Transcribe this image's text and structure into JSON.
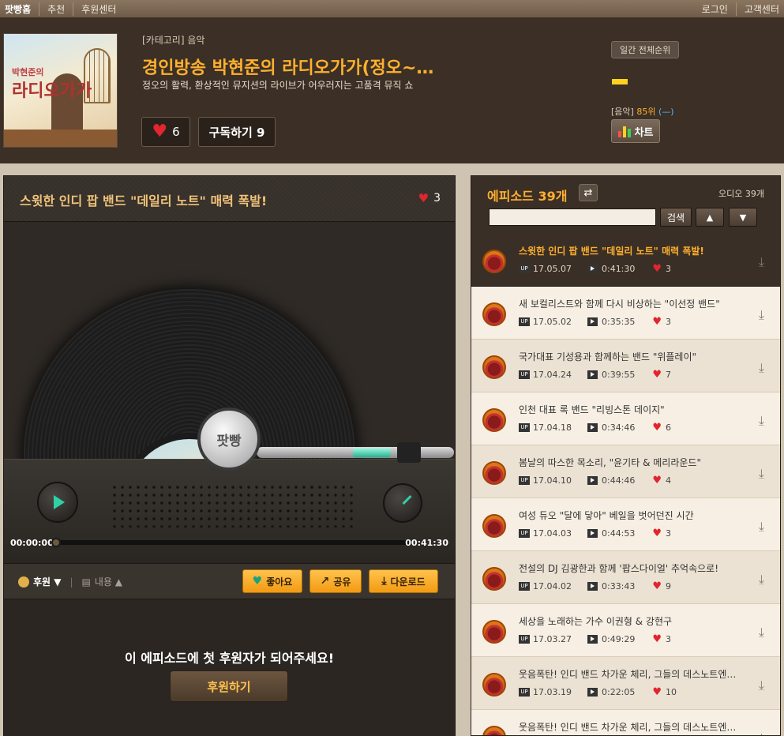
{
  "topbar": {
    "home": "팟빵홈",
    "recommend": "추천",
    "support_center": "후원센터",
    "login": "로그인",
    "customer_center": "고객센터"
  },
  "channel": {
    "category": "[카테고리] 음악",
    "title": "경인방송 박현준의 라디오가가(정오~…",
    "description": "정오의 활력, 환상적인 뮤지션의 라이브가 어우러지는 고품격 뮤직 쇼",
    "likes": "6",
    "subscribe_label": "구독하기 9",
    "thumb_line1": "박현준의",
    "thumb_line2": "라디오가가",
    "rank_button": "일간 전체순위",
    "rank_category": "[음악]",
    "rank_value": "85위",
    "rank_change": "(—)",
    "chart_button": "차트",
    "colors": {
      "accent": "#ffb02e",
      "like_red": "#e0262e",
      "rank_bar": "#ffd21e"
    }
  },
  "player": {
    "episode_title": "스윗한 인디 팝 밴드 \"데일리 노트\" 매력 폭발!",
    "likes": "3",
    "hub_logo": "팟빵",
    "current_time": "00:00:00",
    "total_time": "00:41:30",
    "progress": 0,
    "support_label": "후원 ▼",
    "memo_label": "내용 ▲",
    "like_button": "좋아요",
    "share_button": "공유",
    "download_button": "다운로드",
    "donate_message": "이 에피소드에 첫 후원자가 되어주세요!",
    "donate_button": "후원하기"
  },
  "episodes": {
    "header": "에피소드 39개",
    "audio_count": "오디오 39개",
    "search_placeholder": "",
    "search_button": "검색",
    "items": [
      {
        "title": "스윗한 인디 팝 밴드 \"데일리 노트\" 매력 폭발!",
        "date": "17.05.07",
        "duration": "0:41:30",
        "likes": "3"
      },
      {
        "title": "새 보컬리스트와 함께 다시 비상하는 \"이선정 밴드\"",
        "date": "17.05.02",
        "duration": "0:35:35",
        "likes": "3"
      },
      {
        "title": "국가대표 기성용과 함께하는 밴드 \"위플레이\"",
        "date": "17.04.24",
        "duration": "0:39:55",
        "likes": "7"
      },
      {
        "title": "인천 대표 록 밴드 \"리빙스톤 데이지\"",
        "date": "17.04.18",
        "duration": "0:34:46",
        "likes": "6"
      },
      {
        "title": "봄날의 따스한 목소리, \"윤기타 & 메리라운드\"",
        "date": "17.04.10",
        "duration": "0:44:46",
        "likes": "4"
      },
      {
        "title": "여성 듀오 \"달에 닿아\" 베일을 벗어던진 시간",
        "date": "17.04.03",
        "duration": "0:44:53",
        "likes": "3"
      },
      {
        "title": "전설의 DJ 김광한과 함께 '팝스다이얼' 추억속으로!",
        "date": "17.04.02",
        "duration": "0:33:43",
        "likes": "9"
      },
      {
        "title": "세상을 노래하는 가수 이권형 & 강현구",
        "date": "17.03.27",
        "duration": "0:49:29",
        "likes": "3"
      },
      {
        "title": "웃음폭탄! 인디 밴드 차가운 체리, 그들의 데스노트엔…",
        "date": "17.03.19",
        "duration": "0:22:05",
        "likes": "10"
      },
      {
        "title": "웃음폭탄! 인디 밴드 차가운 체리, 그들의 데스노트엔…",
        "date": "",
        "duration": "",
        "likes": ""
      }
    ]
  }
}
